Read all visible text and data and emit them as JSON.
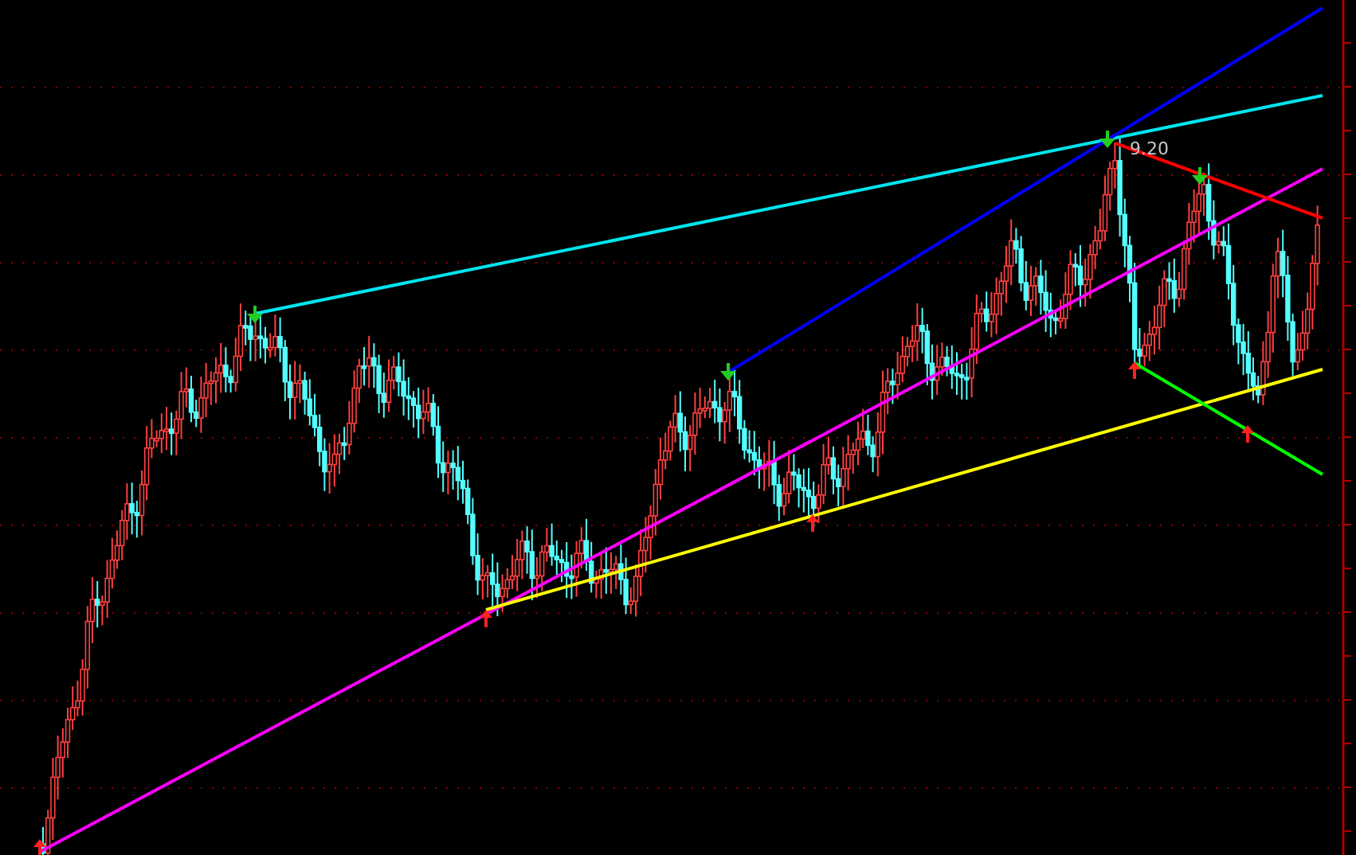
{
  "chart": {
    "price_label": "9.20"
  }
}
